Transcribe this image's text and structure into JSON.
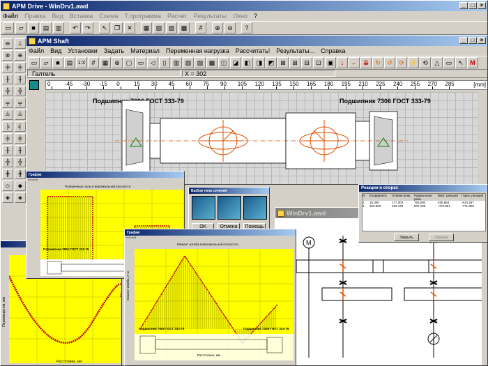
{
  "main": {
    "title": "APM Drive - WinDrv1.awd",
    "menu": [
      "Файл",
      "Правка",
      "Вид",
      "Вставка",
      "Схема",
      "Т.программа",
      "Расчет",
      "Результаты",
      "Окно",
      "?"
    ]
  },
  "shaft": {
    "title": "APM Shaft",
    "menu": [
      "Файл",
      "Вид",
      "Установки",
      "Задать",
      "Материал",
      "Переменная нагрузка",
      "Рассчитать!",
      "Результаты...",
      "Справка"
    ],
    "status_left": "Галтель",
    "status_x": "X = 302",
    "ruler_unit": "[mm]",
    "ruler_ticks": [
      "0",
      "-45",
      "-30",
      "-15",
      "0",
      "15",
      "30",
      "45",
      "60",
      "75",
      "90",
      "105",
      "120",
      "135",
      "150",
      "165",
      "180",
      "195",
      "210",
      "225",
      "240",
      "255",
      "270",
      "285"
    ],
    "bearing_left": "Подшипник 7606 ГОСТ 333-79",
    "bearing_right": "Подшипник 7306 ГОСТ 333-79"
  },
  "graph1": {
    "title": "График",
    "subtitle": "Поперечные силы в вертикальной плоскости",
    "label": "Подшипник 7606 ГОСТ 333-79"
  },
  "graph2": {
    "title": "График",
    "subtitle": "Момент изгиба в вертикальной плоскости",
    "label_left": "Подшипник 7606 ГОСТ 333-79",
    "label_right": "Подшипник 7306 ГОСТ 333-79",
    "xlabel": "Расстояние, мм",
    "ylabel": "Момент изгиба, Н·м"
  },
  "graph0": {
    "ylabel": "Перемещения, мм",
    "xlabel": "Расстояние, мм"
  },
  "choice": {
    "title": "Выбор типа сечения",
    "ok": "ОК",
    "cancel": "Отмена",
    "help": "Помощь"
  },
  "reactions": {
    "title": "Реакции в опорах",
    "headers": [
      "N",
      "Координата",
      "Осевая реак.",
      "Радиальная реак.",
      "Верт. реакция",
      "Гориз. реакция"
    ],
    "rows": [
      [
        "1",
        "15.000",
        "177.000",
        "763.093",
        "455.964",
        "-634.267"
      ],
      [
        "2",
        "226.000",
        "233.478",
        "907.186",
        "-476.891",
        "-771.329"
      ]
    ],
    "close": "Закрыть",
    "help": "Справка"
  },
  "drv": {
    "title": "WinDrv1.awd"
  }
}
